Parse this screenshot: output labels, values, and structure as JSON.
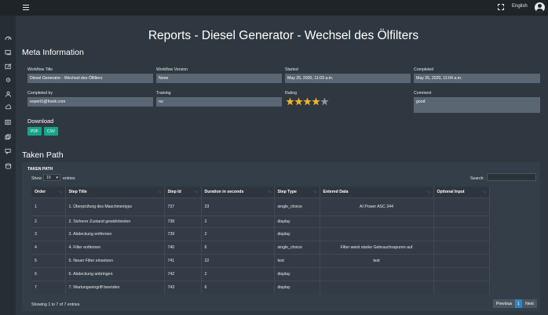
{
  "topbar": {
    "language": "English"
  },
  "sidebar": {
    "icons": [
      "dashboard-icon",
      "workflow-icon",
      "edit-icon",
      "settings-icon",
      "user-icon",
      "cloud-icon",
      "report-icon",
      "copy-icon",
      "chat-icon",
      "database-icon"
    ]
  },
  "page_title": "Reports - Diesel Generator - Wechsel des Ölfilters",
  "meta": {
    "heading": "Meta Information",
    "workflow_title_label": "Workflow Title",
    "workflow_title": "Diesel Generator - Wechsel des Ölfilters",
    "workflow_version_label": "Workflow Version",
    "workflow_version": "None",
    "started_label": "Started",
    "started": "May 25, 2020, 11:03 a.m.",
    "completed_label": "Completed",
    "completed": "May 25, 2020, 11:04 a.m.",
    "completed_by_label": "Completed by",
    "completed_by": "expert1@frank.com",
    "training_label": "Training",
    "training": "no",
    "rating_label": "Rating",
    "rating": 4,
    "rating_max": 5,
    "comment_label": "Comment",
    "comment": "good"
  },
  "download": {
    "heading": "Download",
    "pdf": "PDF",
    "csv": "CSV"
  },
  "taken_path": {
    "heading": "Taken Path",
    "panel_label": "TAKEN PATH",
    "show_label": "Show",
    "entries_value": "10",
    "entries_label": "entries",
    "search_label": "Search:",
    "columns": [
      "Order",
      "Step Title",
      "Step Id",
      "Duration in seconds",
      "Step Type",
      "Entered Data",
      "Optional Input"
    ],
    "rows": [
      [
        "1",
        "1. Überprüfung des Maschinentyps",
        "737",
        "23",
        "single_choice",
        "AI Power ASC 344",
        ""
      ],
      [
        "2",
        "2. Sicherer Zustand gewährleisten",
        "738",
        "2",
        "display",
        "",
        ""
      ],
      [
        "3",
        "3. Abdeckung entfernen",
        "739",
        "2",
        "display",
        "",
        ""
      ],
      [
        "4",
        "4. Filter entfernen",
        "740",
        "6",
        "single_choice",
        "Filter weist starke Gebrauchsspuren auf",
        ""
      ],
      [
        "5",
        "5. Neuer Filter einsetzen",
        "741",
        "22",
        "text",
        "test",
        ""
      ],
      [
        "6",
        "6. Abdeckung anbringen",
        "742",
        "2",
        "display",
        "",
        ""
      ],
      [
        "7",
        "7. Wartungseingriff beenden",
        "743",
        "6",
        "display",
        "",
        ""
      ]
    ],
    "showing": "Showing 1 to 7 of 7 entries",
    "previous": "Previous",
    "page": "1",
    "next": "Next"
  }
}
